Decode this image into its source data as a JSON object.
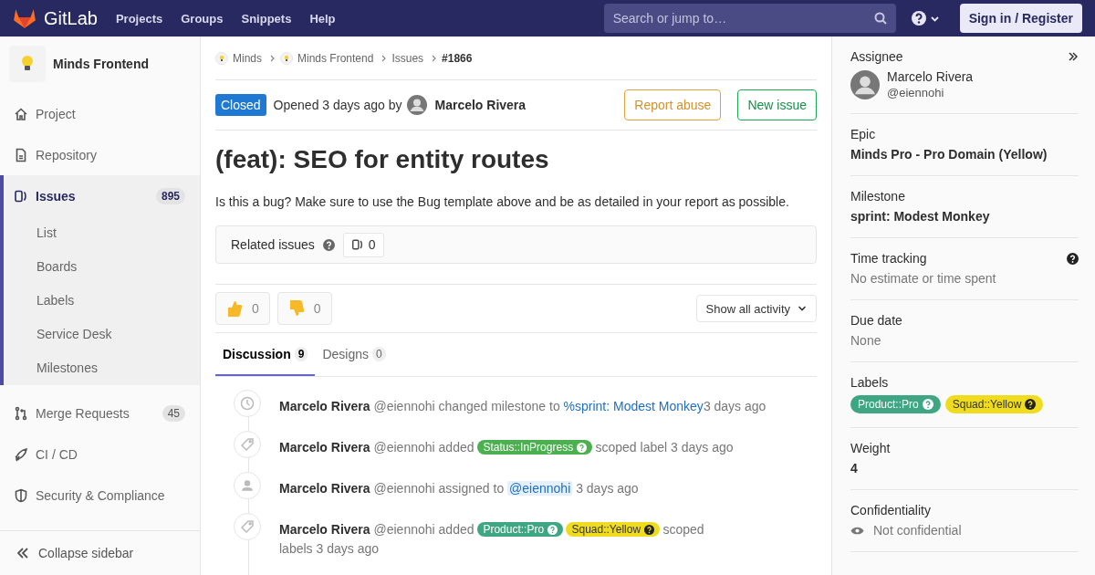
{
  "header": {
    "logo": "GitLab",
    "nav": [
      "Projects",
      "Groups",
      "Snippets",
      "Help"
    ],
    "search": {
      "placeholder": "Search or jump to…"
    },
    "sign_in": "Sign in / Register"
  },
  "sidebar": {
    "project": "Minds Frontend",
    "items": [
      {
        "kind": "home",
        "label": "Project",
        "selected": false
      },
      {
        "kind": "file",
        "label": "Repository",
        "selected": false
      },
      {
        "kind": "issues",
        "label": "Issues",
        "count": "895",
        "selected": true,
        "children": [
          {
            "label": "List"
          },
          {
            "label": "Boards"
          },
          {
            "label": "Labels"
          },
          {
            "label": "Service Desk"
          },
          {
            "label": "Milestones"
          }
        ]
      },
      {
        "kind": "merge",
        "label": "Merge Requests",
        "count": "45",
        "selected": false
      },
      {
        "kind": "rocket",
        "label": "CI / CD",
        "selected": false
      },
      {
        "kind": "shield",
        "label": "Security & Compliance",
        "selected": false
      }
    ],
    "collapse": "Collapse sidebar"
  },
  "breadcrumbs": [
    {
      "label": "Minds",
      "kind": "project"
    },
    {
      "label": "Minds Frontend",
      "kind": "project"
    },
    {
      "label": "Issues",
      "kind": "link"
    },
    {
      "label": "#1866",
      "kind": "current"
    }
  ],
  "issue": {
    "status": "Closed",
    "opened": "Opened 3 days ago by",
    "author": "Marcelo Rivera",
    "title": "(feat): SEO for entity routes",
    "description": "Is this a bug? Make sure to use the Bug template above and be as detailed in your report as possible.",
    "buttons": [
      {
        "label": "Report abuse",
        "kind": "warning"
      },
      {
        "label": "New issue",
        "kind": "success"
      }
    ]
  },
  "related": {
    "label": "Related issues",
    "count": "0"
  },
  "reactions": [
    {
      "kind": "up",
      "count": "0"
    },
    {
      "kind": "down",
      "count": "0"
    }
  ],
  "activity_filter": "Show all activity",
  "tabs": [
    {
      "label": "Discussion",
      "count": "9",
      "selected": true
    },
    {
      "label": "Designs",
      "count": "0",
      "selected": false
    }
  ],
  "activity": [
    {
      "kind": "clock",
      "author": "Marcelo Rivera",
      "handle": "@eiennohi",
      "parts": [
        {
          "kind": "text",
          "text": "changed milestone to"
        },
        {
          "kind": "link",
          "text": "%sprint: Modest Monkey"
        }
      ],
      "time": "3 days ago"
    },
    {
      "kind": "tag",
      "author": "Marcelo Rivera",
      "handle": "@eiennohi",
      "parts": [
        {
          "kind": "text",
          "text": "added"
        },
        {
          "kind": "label",
          "text": "Status::InProgress",
          "color": "#4cb050"
        },
        {
          "kind": "text",
          "text": "scoped label"
        }
      ],
      "time": "3 days ago"
    },
    {
      "kind": "person",
      "author": "Marcelo Rivera",
      "handle": "@eiennohi",
      "parts": [
        {
          "kind": "text",
          "text": "assigned to"
        },
        {
          "kind": "mention",
          "text": "@eiennohi"
        }
      ],
      "time": "3 days ago"
    },
    {
      "kind": "tag",
      "author": "Marcelo Rivera",
      "handle": "@eiennohi",
      "parts": [
        {
          "kind": "text",
          "text": "added"
        },
        {
          "kind": "label",
          "text": "Product::Pro",
          "color": "#3ea682"
        },
        {
          "kind": "label",
          "text": "Squad::Yellow",
          "color": "#f0dc1e"
        },
        {
          "kind": "text",
          "text": "scoped labels"
        }
      ],
      "time": "3 days ago"
    }
  ],
  "right": {
    "assignee": {
      "heading": "Assignee",
      "name": "Marcelo Rivera",
      "handle": "@eiennohi"
    },
    "sections": [
      {
        "kind": "bold",
        "heading": "Epic",
        "value": "Minds Pro - Pro Domain (Yellow)"
      },
      {
        "kind": "bold",
        "heading": "Milestone",
        "value": "sprint: Modest Monkey"
      },
      {
        "kind": "muted",
        "heading": "Time tracking",
        "value": "No estimate or time spent",
        "help": true
      },
      {
        "kind": "muted",
        "heading": "Due date",
        "value": "None"
      },
      {
        "kind": "labels",
        "heading": "Labels",
        "labels": [
          {
            "text": "Product::Pro",
            "color": "#3ea682"
          },
          {
            "text": "Squad::Yellow",
            "color": "#f0dc1e"
          }
        ]
      },
      {
        "kind": "bold",
        "heading": "Weight",
        "value": "4"
      },
      {
        "kind": "eye",
        "heading": "Confidentiality",
        "value": "Not confidential"
      }
    ]
  }
}
